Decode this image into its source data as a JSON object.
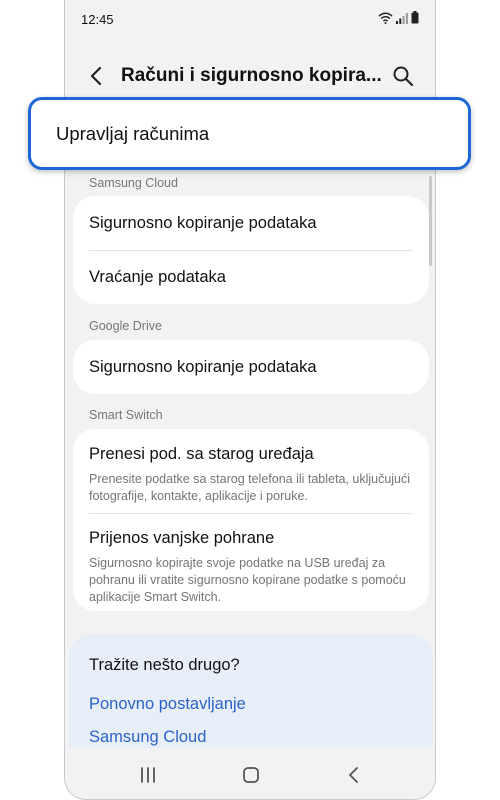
{
  "status_bar": {
    "time": "12:45"
  },
  "header": {
    "title": "Računi i sigurnosno kopira..."
  },
  "highlight": {
    "label": "Upravljaj računima"
  },
  "sections": {
    "samsung_cloud": {
      "label": "Samsung Cloud",
      "items": [
        {
          "title": "Sigurnosno kopiranje podataka"
        },
        {
          "title": "Vraćanje podataka"
        }
      ]
    },
    "google_drive": {
      "label": "Google Drive",
      "items": [
        {
          "title": "Sigurnosno kopiranje podataka"
        }
      ]
    },
    "smart_switch": {
      "label": "Smart Switch",
      "items": [
        {
          "title": "Prenesi pod. sa starog uređaja",
          "desc": "Prenesite podatke sa starog telefona ili tableta, uključujući fotografije, kontakte, aplikacije i poruke."
        },
        {
          "title": "Prijenos vanjske pohrane",
          "desc": "Sigurnosno kopirajte svoje podatke na USB uređaj za pohranu ili vratite sigurnosno kopirane podatke s pomoću aplikacije Smart Switch."
        }
      ]
    }
  },
  "suggestions": {
    "title": "Tražite nešto drugo?",
    "links": [
      "Ponovno postavljanje",
      "Samsung Cloud"
    ]
  },
  "colors": {
    "accent": "#1e68d5",
    "link": "#2a63c6",
    "background": "#f2f2f3"
  },
  "icons": [
    "back-arrow-icon",
    "search-icon",
    "wifi-icon",
    "signal-icon",
    "battery-icon",
    "recents-icon",
    "home-icon",
    "nav-back-icon"
  ]
}
